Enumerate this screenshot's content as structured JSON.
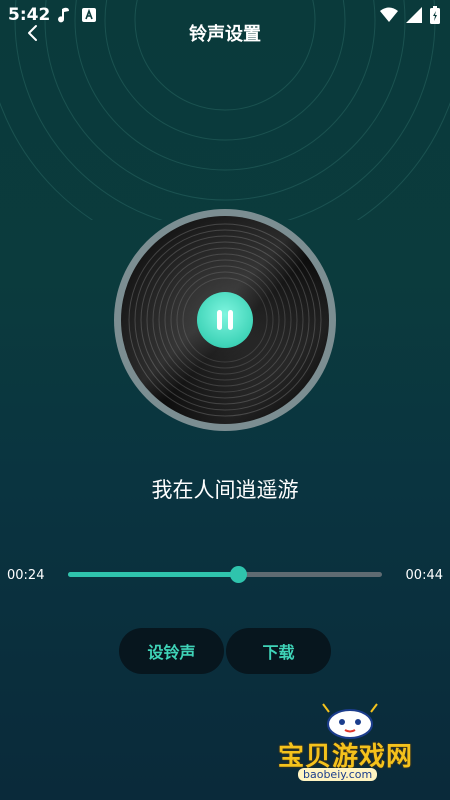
{
  "status_bar": {
    "time": "5:42"
  },
  "header": {
    "title": "铃声设置"
  },
  "player": {
    "song_title": "我在人间逍遥游",
    "current_time": "00:24",
    "total_time": "00:44",
    "progress_fraction": 0.54,
    "state": "playing"
  },
  "actions": {
    "set_ringtone": "设铃声",
    "download": "下载"
  },
  "watermark": {
    "brand": "宝贝游戏网",
    "url": "baobeiy.com"
  },
  "colors": {
    "accent": "#2fc4ad",
    "button_bg": "#07161e",
    "button_text": "#3fd4b8",
    "track": "#5f6b72"
  }
}
